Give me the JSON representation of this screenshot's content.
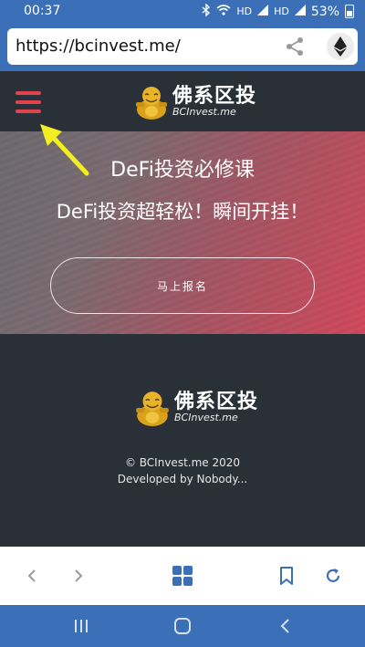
{
  "status_bar": {
    "time": "00:37",
    "network_1": "HD",
    "network_2": "HD",
    "battery": "53%"
  },
  "address_bar": {
    "url": "https://bcinvest.me/"
  },
  "site": {
    "logo_cn": "佛系区投",
    "logo_en": "BCInvest.me",
    "hero_title": "DeFi投资必修课",
    "hero_subtitle": "DeFi投资超轻松！瞬间开挂！",
    "signup_label": "马上报名",
    "footer_copyright": "© BCInvest.me 2020",
    "footer_developer": "Developed by Nobody..."
  },
  "colors": {
    "accent": "#e0424f",
    "status_bar": "#3b6fb8",
    "header_bg": "#2a3038",
    "arrow": "#f2ee22"
  }
}
